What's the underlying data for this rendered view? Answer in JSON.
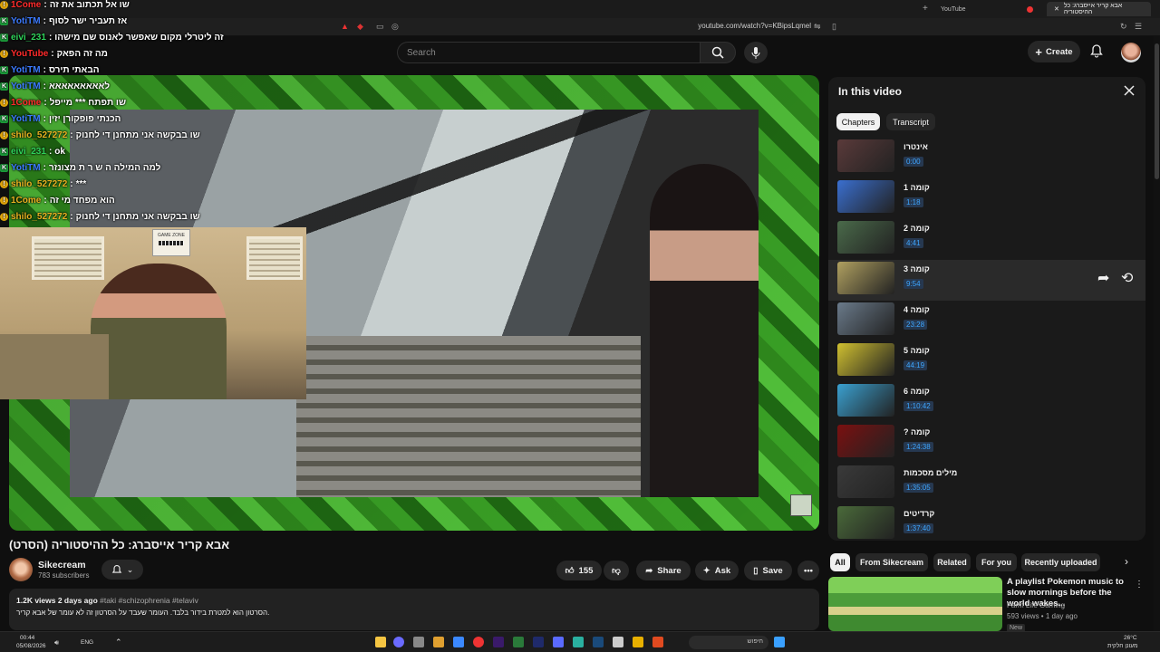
{
  "browser": {
    "tabs": [
      {
        "label": "YouTube"
      },
      {
        "label": "אבא קריר אייסברג: כל ההיסטוריה"
      }
    ],
    "url": "youtube.com/watch?v=KBipsLqmel"
  },
  "header": {
    "search_placeholder": "Search",
    "create_label": "Create"
  },
  "chat": [
    {
      "user": "1Come",
      "text": "שו אל תכתוב את זה",
      "color": "red"
    },
    {
      "user": "YotiTM",
      "text": "אז תעביר ישר לסוף",
      "color": "blue"
    },
    {
      "user": "eivi_231",
      "text": "זה ליטרלי מקום שאפשר לאנוס שם מישהו",
      "color": "green"
    },
    {
      "user": "YouTube",
      "text": "מה זה הפאק",
      "color": "red"
    },
    {
      "user": "YotiTM",
      "text": "הבאתי תירס",
      "color": "blue"
    },
    {
      "user": "YotiTM",
      "text": "לאאאאאאאאא",
      "color": "blue"
    },
    {
      "user": "1Come",
      "text": "שו תפתח *** מייפל",
      "color": "red"
    },
    {
      "user": "YotiTM",
      "text": "הכנתי פופקורן יזין",
      "color": "blue"
    },
    {
      "user": "shilo_527272",
      "text": "שו בבקשה אני מתחנן די לחנוק",
      "color": "gold"
    },
    {
      "user": "eivi_231",
      "text": "ok",
      "color": "green"
    },
    {
      "user": "YotiTM",
      "text": "למה המילה ה ש ר ת מצונזר",
      "color": "blue"
    },
    {
      "user": "shilo_527272",
      "text": "***",
      "color": "gold"
    },
    {
      "user": "1Come",
      "text": "הוא מפחד מי זה",
      "color": "gold"
    },
    {
      "user": "shilo_527272",
      "text": "שו בבקשה אני מתחנן די לחנוק",
      "color": "gold"
    }
  ],
  "facecam": {
    "sign": "GAME ZONE"
  },
  "video": {
    "title": "אבא קריר אייסברג: כל ההיסטוריה (הסרט)",
    "channel": "Sikecream",
    "subscribers": "783 subscribers",
    "likes": "155",
    "share_label": "Share",
    "ask_label": "Ask",
    "save_label": "Save",
    "views_date": "1.2K views  2 days ago",
    "tags": "#taki #schizophrenia #telaviv",
    "description": "הסרטון הוא למטרת בידור בלבד. העומר שעבד על הסרטון זה לא עומר של אבא קריר."
  },
  "panel": {
    "title": "In this video",
    "tabs": [
      "Chapters",
      "Transcript"
    ],
    "chapters": [
      {
        "name": "אינטרו",
        "time": "0:00",
        "color": "#5a3a3a"
      },
      {
        "name": "קומה 1",
        "time": "1:18",
        "color": "#3a6fd0"
      },
      {
        "name": "קומה 2",
        "time": "4:41",
        "color": "#4a6a4a"
      },
      {
        "name": "קומה 3",
        "time": "9:54",
        "color": "#b0a060"
      },
      {
        "name": "קומה 4",
        "time": "23:28",
        "color": "#6a7a8a"
      },
      {
        "name": "קומה 5",
        "time": "44:19",
        "color": "#d0c030"
      },
      {
        "name": "קומה 6",
        "time": "1:10:42",
        "color": "#3aa0d0"
      },
      {
        "name": "קומה ?",
        "time": "1:24:38",
        "color": "#7a1010"
      },
      {
        "name": "מילים מסכמות",
        "time": "1:35:05",
        "color": "#3a3a3a"
      },
      {
        "name": "קרדיטים",
        "time": "1:37:40",
        "color": "#4a6a3a"
      }
    ]
  },
  "chips": [
    "All",
    "From Sikecream",
    "Related",
    "For you",
    "Recently uploaded"
  ],
  "recommendation": {
    "title": "A playlist Pokemon music to slow mornings before the world wakes...",
    "channel": "Farm Life Gaming",
    "meta": "593 views • 1 day ago",
    "badge": "New"
  },
  "taskbar": {
    "time": "00:44",
    "date": "05/08/2026",
    "lang": "ENG",
    "search": "חיפוש",
    "weather": "26°C",
    "weather_desc": "מעונן חלקית"
  },
  "colors": {
    "accent_blue": "#3ea6ff",
    "chat_green": "#2fd35a",
    "chat_blue": "#3c7bff",
    "chat_red": "#ff2b2b",
    "chat_gold": "#e7b120"
  }
}
